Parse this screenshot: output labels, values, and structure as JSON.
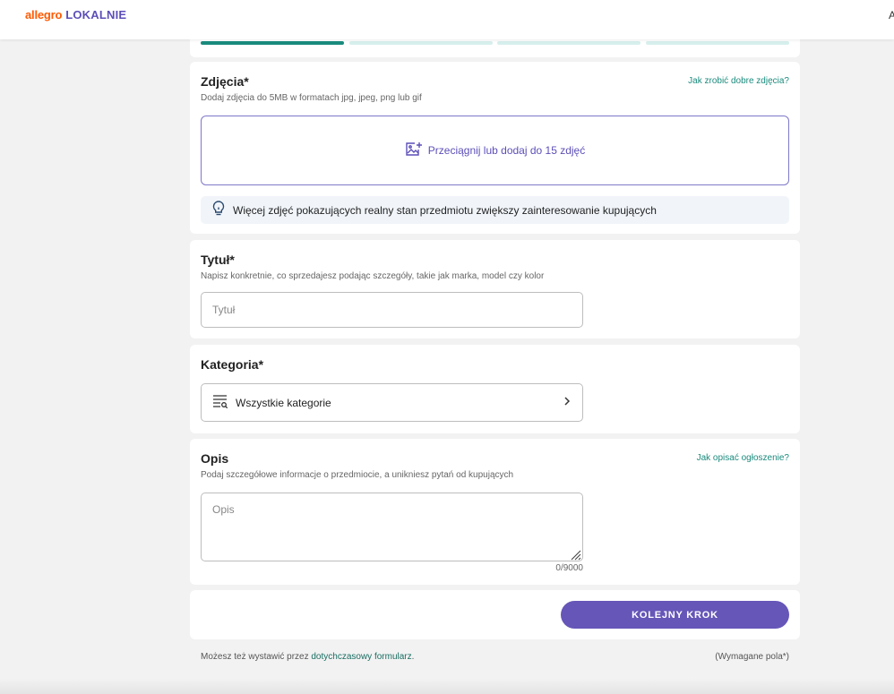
{
  "header": {
    "logo_part1": "allegro",
    "logo_part2": "LOKALNIE",
    "edge_text": "A"
  },
  "progress": {
    "steps": 4,
    "current": 1
  },
  "photos": {
    "title": "Zdjęcia*",
    "subtitle": "Dodaj zdjęcia do 5MB w formatach jpg, jpeg, png lub gif",
    "help_link": "Jak zrobić dobre zdjęcia?",
    "dropzone_label": "Przeciągnij lub dodaj do 15 zdjęć",
    "dropzone_icon": "image-add-icon",
    "tip_icon": "lightbulb-icon",
    "tip_text": "Więcej zdjęć pokazujących realny stan przedmiotu zwiększy zainteresowanie kupujących"
  },
  "title_section": {
    "title": "Tytuł*",
    "subtitle": "Napisz konkretnie, co sprzedajesz podając szczegóły, takie jak marka, model czy kolor",
    "placeholder": "Tytuł",
    "value": ""
  },
  "category": {
    "title": "Kategoria*",
    "select_label": "Wszystkie kategorie",
    "select_icon": "category-search-icon",
    "chevron_icon": "chevron-right-icon"
  },
  "description": {
    "title": "Opis",
    "subtitle": "Podaj szczegółowe informacje o przedmiocie, a unikniesz pytań od kupujących",
    "help_link": "Jak opisać ogłoszenie?",
    "placeholder": "Opis",
    "value": "",
    "counter": "0/9000"
  },
  "actions": {
    "next_label": "KOLEJNY KROK"
  },
  "footer": {
    "prefix": "Możesz też wystawić przez ",
    "link": "dotychczasowy formularz",
    "suffix": ".",
    "required_note": "(Wymagane pola*)"
  },
  "colors": {
    "brand_orange": "#ff5a00",
    "brand_purple": "#5c4fb8",
    "button_purple": "#6656b8",
    "teal": "#1a8b7d",
    "progress_inactive": "#d6efec"
  }
}
